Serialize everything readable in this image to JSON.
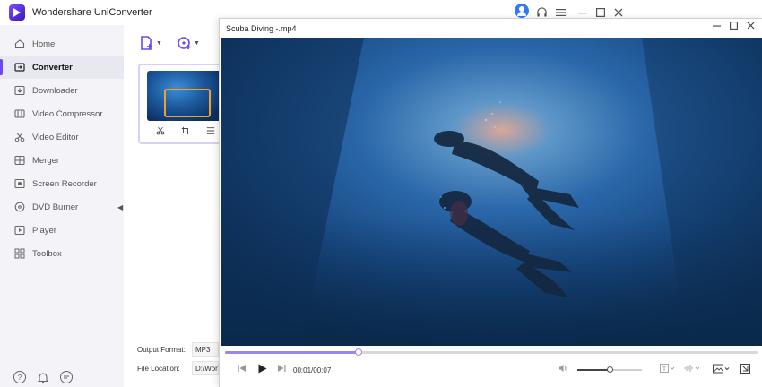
{
  "app": {
    "title": "Wondershare UniConverter",
    "accent_color": "#6c48f2"
  },
  "titlebar_icons": [
    "user-icon",
    "headset-icon",
    "menu-icon",
    "minimize-icon",
    "maximize-icon",
    "close-icon"
  ],
  "sidebar": {
    "items": [
      {
        "label": "Home",
        "icon": "home-icon",
        "active": false
      },
      {
        "label": "Converter",
        "icon": "converter-icon",
        "active": true
      },
      {
        "label": "Downloader",
        "icon": "downloader-icon",
        "active": false
      },
      {
        "label": "Video Compressor",
        "icon": "compressor-icon",
        "active": false
      },
      {
        "label": "Video Editor",
        "icon": "scissors-icon",
        "active": false
      },
      {
        "label": "Merger",
        "icon": "merger-icon",
        "active": false
      },
      {
        "label": "Screen Recorder",
        "icon": "screen-recorder-icon",
        "active": false
      },
      {
        "label": "DVD Burner",
        "icon": "dvd-icon",
        "active": false
      },
      {
        "label": "Player",
        "icon": "player-icon",
        "active": false
      },
      {
        "label": "Toolbox",
        "icon": "toolbox-icon",
        "active": false
      }
    ],
    "footer_icons": [
      "help-icon",
      "bell-icon",
      "feedback-icon"
    ]
  },
  "converter": {
    "output_format_label": "Output Format:",
    "output_format_value": "MP3",
    "file_location_label": "File Location:",
    "file_location_value": "D:\\Won"
  },
  "player": {
    "title": "Scuba Diving -.mp4",
    "time": "00:01/00:07",
    "progress": 0.25,
    "volume": 0.5
  }
}
